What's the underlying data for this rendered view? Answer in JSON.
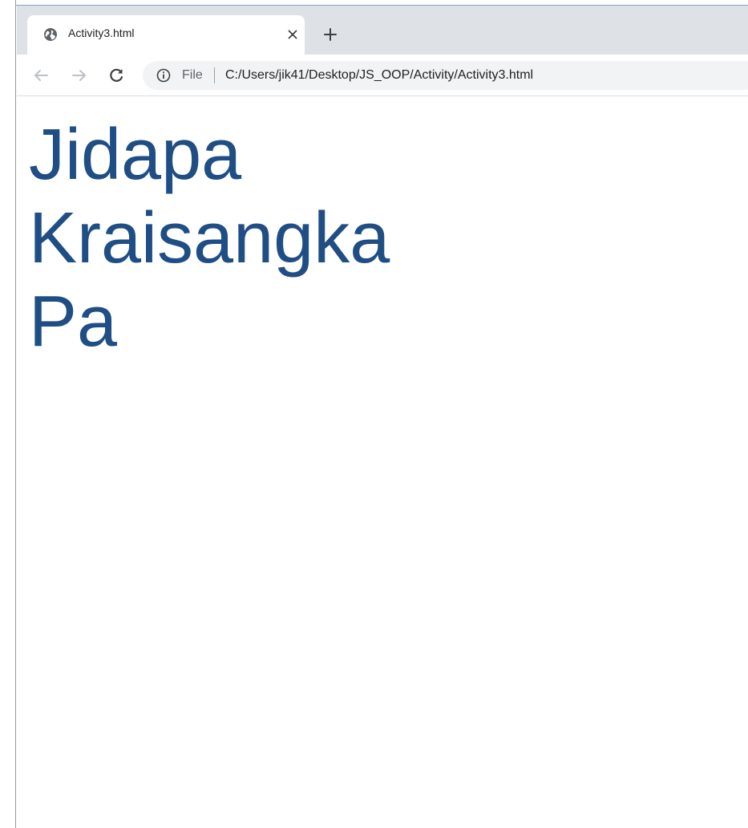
{
  "browser": {
    "tab": {
      "title": "Activity3.html",
      "favicon": "globe-icon",
      "close_icon": "close-icon"
    },
    "new_tab_icon": "plus-icon",
    "nav": {
      "back_icon": "back-arrow-icon",
      "forward_icon": "forward-arrow-icon",
      "reload_icon": "reload-icon"
    },
    "omnibox": {
      "info_icon": "info-icon",
      "scheme_label": "File",
      "url": "C:/Users/jik41/Desktop/JS_OOP/Activity/Activity3.html"
    }
  },
  "page": {
    "lines": [
      "Jidapa",
      "Kraisangka",
      "Pa"
    ],
    "text_color": "#1f4e85"
  },
  "colors": {
    "tabstrip": "#dee1e6",
    "omnibox": "#f1f3f4"
  }
}
